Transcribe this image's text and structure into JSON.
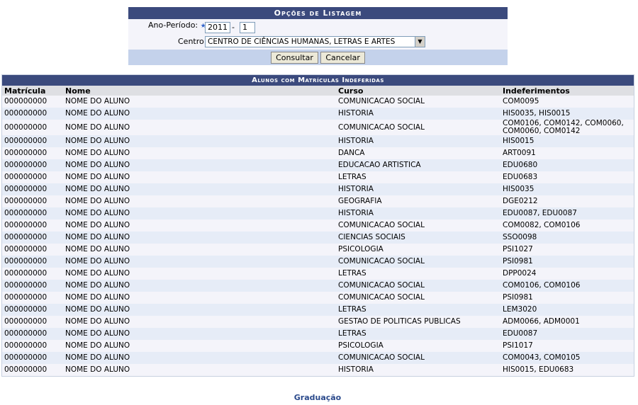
{
  "options": {
    "caption": "Opções de Listagem",
    "ano_label": "Ano-Período:",
    "ano_value": "2011",
    "periodo_sep": "-",
    "periodo_value": "1",
    "centro_label": "Centro",
    "centro_value": "CENTRO DE CIÊNCIAS HUMANAS, LETRAS E ARTES",
    "consultar": "Consultar",
    "cancelar": "Cancelar"
  },
  "list": {
    "caption": "Alunos com Matrículas Indeferidas",
    "headers": [
      "Matrícula",
      "Nome",
      "Curso",
      "Indeferimentos"
    ],
    "rows": [
      [
        "000000000",
        "NOME DO ALUNO",
        "COMUNICACAO SOCIAL",
        "COM0095"
      ],
      [
        "000000000",
        "NOME DO ALUNO",
        "HISTORIA",
        "HIS0035, HIS0015"
      ],
      [
        "000000000",
        "NOME DO ALUNO",
        "COMUNICACAO SOCIAL",
        "COM0106, COM0142, COM0060, COM0060, COM0142"
      ],
      [
        "000000000",
        "NOME DO ALUNO",
        "HISTORIA",
        "HIS0015"
      ],
      [
        "000000000",
        "NOME DO ALUNO",
        "DANCA",
        "ART0091"
      ],
      [
        "000000000",
        "NOME DO ALUNO",
        "EDUCACAO ARTISTICA",
        "EDU0680"
      ],
      [
        "000000000",
        "NOME DO ALUNO",
        "LETRAS",
        "EDU0683"
      ],
      [
        "000000000",
        "NOME DO ALUNO",
        "HISTORIA",
        "HIS0035"
      ],
      [
        "000000000",
        "NOME DO ALUNO",
        "GEOGRAFIA",
        "DGE0212"
      ],
      [
        "000000000",
        "NOME DO ALUNO",
        "HISTORIA",
        "EDU0087, EDU0087"
      ],
      [
        "000000000",
        "NOME DO ALUNO",
        "COMUNICACAO SOCIAL",
        "COM0082, COM0106"
      ],
      [
        "000000000",
        "NOME DO ALUNO",
        "CIENCIAS SOCIAIS",
        "SSO0098"
      ],
      [
        "000000000",
        "NOME DO ALUNO",
        "PSICOLOGIA",
        "PSI1027"
      ],
      [
        "000000000",
        "NOME DO ALUNO",
        "COMUNICACAO SOCIAL",
        "PSI0981"
      ],
      [
        "000000000",
        "NOME DO ALUNO",
        "LETRAS",
        "DPP0024"
      ],
      [
        "000000000",
        "NOME DO ALUNO",
        "COMUNICACAO SOCIAL",
        "COM0106, COM0106"
      ],
      [
        "000000000",
        "NOME DO ALUNO",
        "COMUNICACAO SOCIAL",
        "PSI0981"
      ],
      [
        "000000000",
        "NOME DO ALUNO",
        "LETRAS",
        "LEM3020"
      ],
      [
        "000000000",
        "NOME DO ALUNO",
        "GESTAO DE POLITICAS PUBLICAS",
        "ADM0066, ADM0001"
      ],
      [
        "000000000",
        "NOME DO ALUNO",
        "LETRAS",
        "EDU0087"
      ],
      [
        "000000000",
        "NOME DO ALUNO",
        "PSICOLOGIA",
        "PSI1017"
      ],
      [
        "000000000",
        "NOME DO ALUNO",
        "COMUNICACAO SOCIAL",
        "COM0043, COM0105"
      ],
      [
        "000000000",
        "NOME DO ALUNO",
        "HISTORIA",
        "HIS0015, EDU0683"
      ]
    ]
  },
  "footer": {
    "link": "Graduação"
  },
  "colors": {
    "header_bg": "#3b4a7d",
    "row_odd": "#f4f4fa",
    "row_even": "#e6ecf7",
    "foot_bg": "#c4d2eb",
    "link": "#2b4a8c"
  }
}
